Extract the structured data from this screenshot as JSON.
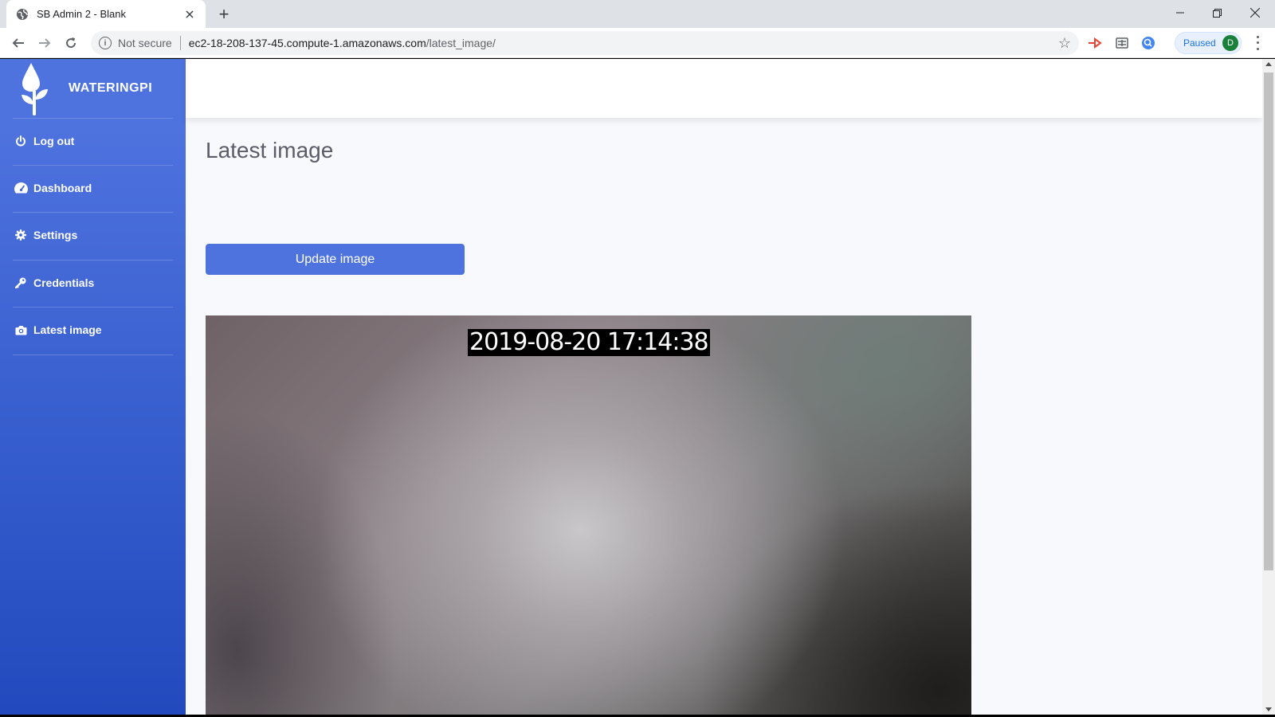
{
  "browser": {
    "tab_title": "SB Admin 2 - Blank",
    "new_tab_symbol": "+",
    "security_label": "Not secure",
    "url_host": "ec2-18-208-137-45.compute-1.amazonaws.com",
    "url_path": "/latest_image/",
    "profile_status": "Paused",
    "profile_initial": "D"
  },
  "sidebar": {
    "brand": "WATERINGPI",
    "items": [
      {
        "label": "Log out",
        "icon": "power-icon"
      },
      {
        "label": "Dashboard",
        "icon": "tachometer-icon"
      },
      {
        "label": "Settings",
        "icon": "gear-icon"
      },
      {
        "label": "Credentials",
        "icon": "key-icon"
      },
      {
        "label": "Latest image",
        "icon": "camera-icon"
      }
    ]
  },
  "main": {
    "title": "Latest image",
    "update_button": "Update image",
    "image_timestamp": "2019-08-20 17:14:38"
  },
  "colors": {
    "primary": "#4e73df",
    "sidebar_gradient_end": "#224abe",
    "title_text": "#5a5c69",
    "page_background": "#f8f9fc"
  }
}
